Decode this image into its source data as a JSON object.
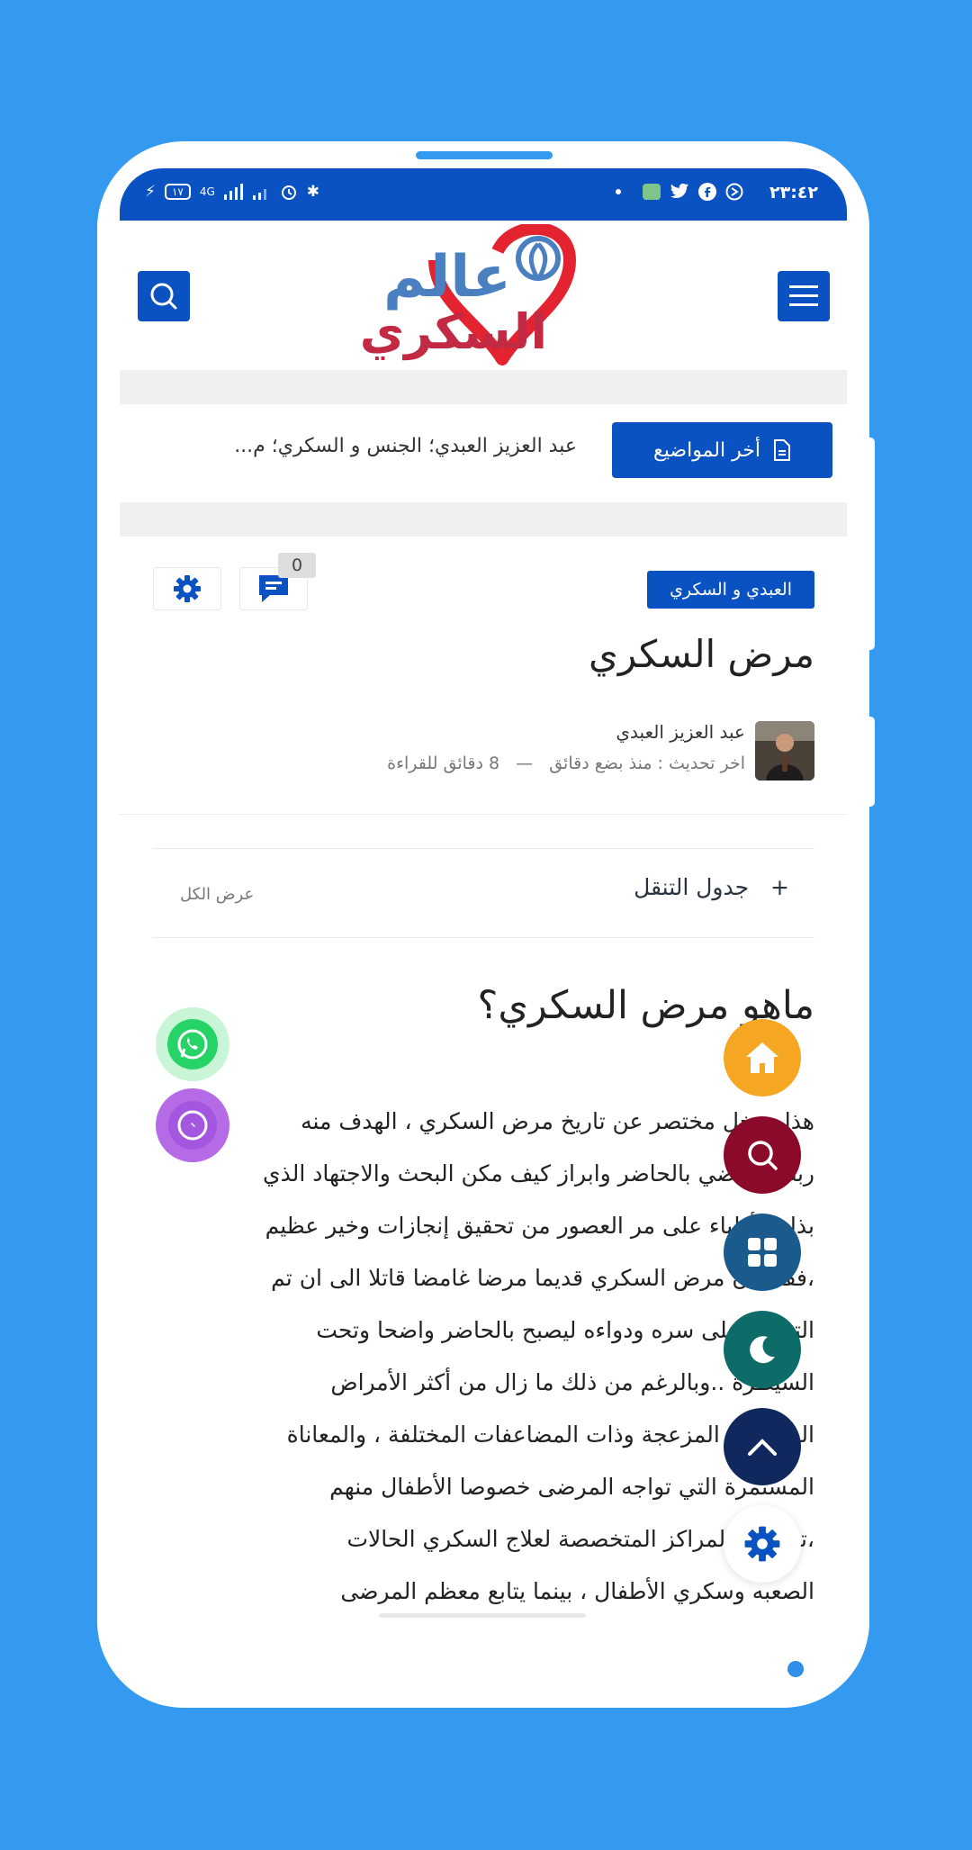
{
  "status_bar": {
    "time": "٢٣:٤٢",
    "battery": "١٧",
    "network": "4G",
    "icons": [
      "vpn-icon",
      "facebook-icon",
      "twitter-icon",
      "app-icon",
      "dot-icon",
      "bluetooth-icon",
      "alarm-icon",
      "signal-icon",
      "battery-icon"
    ]
  },
  "header": {
    "logo_text_top": "عالم",
    "logo_text_bottom": "السكري",
    "menu_icon": "hamburger-icon",
    "search_icon": "search-icon"
  },
  "ticker": {
    "button_label": "أخر المواضيع",
    "headline": "عبد العزيز العبدي؛ الجنس و السكري؛ م..."
  },
  "post": {
    "category": "العبدي و السكري",
    "comment_count": "0",
    "title": "مرض السكري",
    "author": "عبد العزيز العبدي",
    "updated": "اخر تحديث : منذ بضع دقائق",
    "separator": "—",
    "read_time": "8 دقائق للقراءة"
  },
  "toc": {
    "title": "جدول التنقل",
    "expand_symbol": "+",
    "view_all": "عرض الكل"
  },
  "article": {
    "heading": "ماهو مرض السكري؟",
    "lines": [
      "هذا مدخل مختصر عن تاريخ مرض السكري ، الهدف منه",
      "ربط الماضي بالحاضر وابراز كيف مكن البحث والاجتهاد الذي",
      "بذله الأطباء على مر العصور من تحقيق إنجازات وخير عظيم",
      "،فقد كان مرض السكري قديما مرضا غامضا قاتلا الى ان  تم",
      "التعرف على سره ودواءه ليصبح بالحاضر واضحا وتحت",
      "السيطرة ..وبالرغم من ذلك ما زال من أكثر الأمراض",
      "المزمنة و المزعجة وذات المضاعفات المختلفة ، والمعاناة",
      "المستمرة التي تواجه المرضى خصوصا الأطفال منهم",
      "،تستقبل المراكز المتخصصة لعلاج السكري الحالات",
      "الصعبه وسكري الأطفال ، بينما يتابع معظم المرضى"
    ]
  },
  "colors": {
    "brand_blue": "#0a52c2",
    "page_background": "#339af0",
    "home_fab": "#f5a623",
    "search_fab": "#8b0a2a",
    "grid_fab": "#1b5a8c",
    "moon_fab": "#0d6b68",
    "up_fab": "#10285e",
    "whatsapp": "#25d366",
    "messenger": "#a357e0"
  }
}
